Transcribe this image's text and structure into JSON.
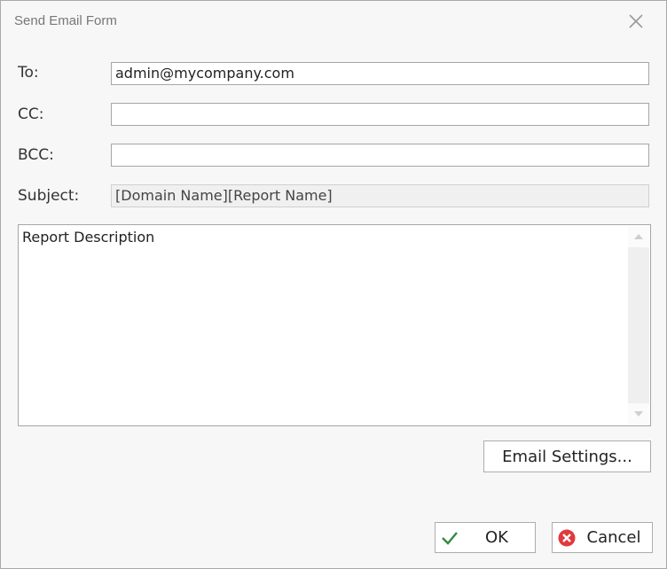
{
  "window": {
    "title": "Send Email Form",
    "close_icon": "close-icon"
  },
  "form": {
    "to": {
      "label": "To:",
      "value": "admin@mycompany.com"
    },
    "cc": {
      "label": "CC:",
      "value": ""
    },
    "bcc": {
      "label": "BCC:",
      "value": ""
    },
    "subject": {
      "label": "Subject:",
      "value": "[Domain Name][Report Name]"
    },
    "body": {
      "value": "Report Description"
    }
  },
  "buttons": {
    "email_settings": "Email Settings...",
    "ok": {
      "label": "OK",
      "icon": "checkmark-icon",
      "icon_color": "#2e8b3e"
    },
    "cancel": {
      "label": "Cancel",
      "icon": "cancel-circle-icon",
      "icon_color": "#e03a3e"
    }
  }
}
